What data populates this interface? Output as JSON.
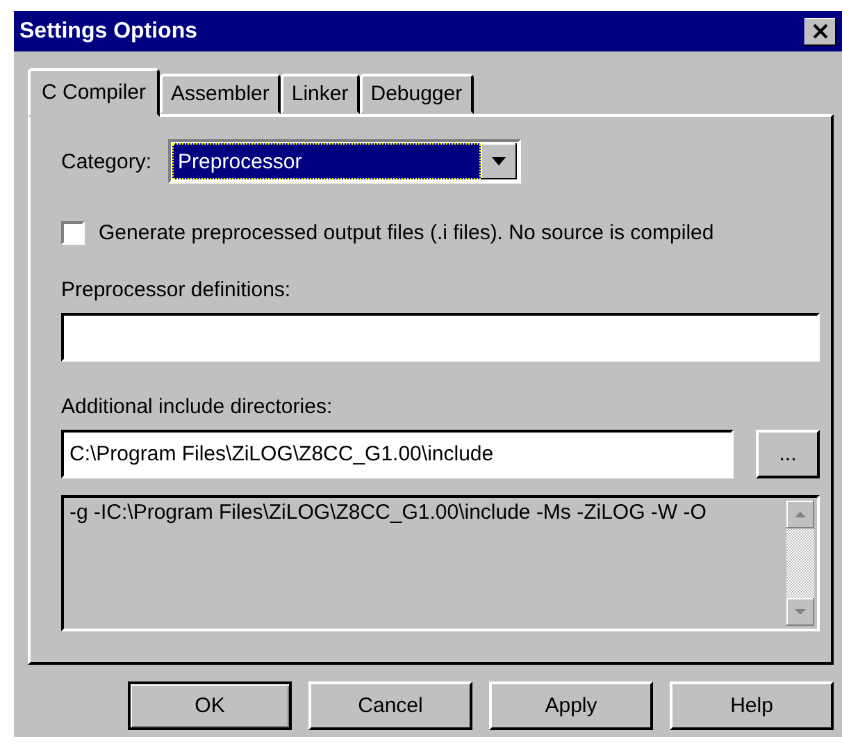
{
  "window": {
    "title": "Settings Options"
  },
  "tabs": [
    {
      "label": "C Compiler",
      "selected": true
    },
    {
      "label": "Assembler",
      "selected": false
    },
    {
      "label": "Linker",
      "selected": false
    },
    {
      "label": "Debugger",
      "selected": false
    }
  ],
  "category": {
    "label": "Category:",
    "value": "Preprocessor"
  },
  "preprocess_checkbox": {
    "label": "Generate preprocessed output files (.i files). No source is compiled",
    "checked": false
  },
  "definitions": {
    "label": "Preprocessor definitions:"
  },
  "include_dirs": {
    "label": "Additional include directories:",
    "value": "C:\\Program Files\\ZiLOG\\Z8CC_G1.00\\include",
    "browse_button": "..."
  },
  "options_text": "-g -IC:\\Program Files\\ZiLOG\\Z8CC_G1.00\\include -Ms -ZiLOG -W -O",
  "buttons": [
    {
      "label": "OK",
      "default": true
    },
    {
      "label": "Cancel",
      "default": false
    },
    {
      "label": "Apply",
      "default": false
    },
    {
      "label": "Help",
      "default": false
    }
  ]
}
